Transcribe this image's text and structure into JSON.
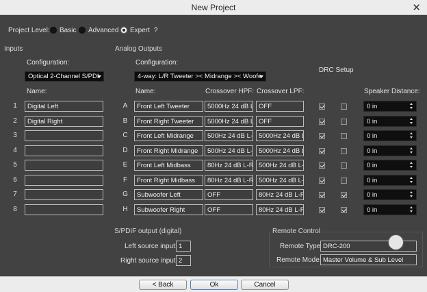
{
  "window": {
    "title": "New Project",
    "close_glyph": "✕"
  },
  "project_level": {
    "label": "Project Level:",
    "options": [
      {
        "label": "Basic",
        "selected": false
      },
      {
        "label": "Advanced",
        "selected": false
      },
      {
        "label": "Expert",
        "selected": true
      }
    ],
    "help": "?"
  },
  "inputs": {
    "section_title": "Inputs",
    "config_label": "Configuration:",
    "config_value": "Optical 2-Channel S/PDI",
    "name_header": "Name:",
    "rows": [
      {
        "index": "1",
        "name": "Digital Left"
      },
      {
        "index": "2",
        "name": "Digital Right"
      },
      {
        "index": "3",
        "name": ""
      },
      {
        "index": "4",
        "name": ""
      },
      {
        "index": "5",
        "name": ""
      },
      {
        "index": "6",
        "name": ""
      },
      {
        "index": "7",
        "name": ""
      },
      {
        "index": "8",
        "name": ""
      }
    ]
  },
  "outputs": {
    "section_title": "Analog Outputs",
    "config_label": "Configuration:",
    "config_value": "4-way: L/R Tweeter >< Midrange >< Woofe",
    "drc_header": "DRC Setup",
    "headers": {
      "name": "Name:",
      "hpf": "Crossover HPF:",
      "lpf": "Crossover LPF:",
      "distance": "Speaker Distance:"
    },
    "rows": [
      {
        "letter": "A",
        "name": "Front Left Tweeter",
        "hpf": "5000Hz 24 dB L-R",
        "lpf": "OFF",
        "drc1": true,
        "drc2": false,
        "distance": "0 in"
      },
      {
        "letter": "B",
        "name": "Front Right Tweeter",
        "hpf": "5000Hz 24 dB L-R",
        "lpf": "OFF",
        "drc1": true,
        "drc2": false,
        "distance": "0 in"
      },
      {
        "letter": "C",
        "name": "Front Left Midrange",
        "hpf": "500Hz 24 dB L-R",
        "lpf": "5000Hz 24 dB L-R",
        "drc1": true,
        "drc2": false,
        "distance": "0 in"
      },
      {
        "letter": "D",
        "name": "Front Right Midrange",
        "hpf": "500Hz 24 dB L-R",
        "lpf": "5000Hz 24 dB L-R",
        "drc1": true,
        "drc2": false,
        "distance": "0 in"
      },
      {
        "letter": "E",
        "name": "Front Left Midbass",
        "hpf": "80Hz 24 dB L-R",
        "lpf": "500Hz 24 dB L-R",
        "drc1": true,
        "drc2": false,
        "distance": "0 in"
      },
      {
        "letter": "F",
        "name": "Front Right Midbass",
        "hpf": "80Hz 24 dB L-R",
        "lpf": "500Hz 24 dB L-R",
        "drc1": true,
        "drc2": false,
        "distance": "0 in"
      },
      {
        "letter": "G",
        "name": "Subwoofer Left",
        "hpf": "OFF",
        "lpf": "80Hz 24 dB L-R",
        "drc1": true,
        "drc2": true,
        "distance": "0 in"
      },
      {
        "letter": "H",
        "name": "Subwoofer Right",
        "hpf": "OFF",
        "lpf": "80Hz 24 dB L-R",
        "drc1": true,
        "drc2": true,
        "distance": "0 in"
      }
    ]
  },
  "spdif": {
    "section_title": "S/PDIF output (digital)",
    "left_label": "Left source input:",
    "left_value": "1",
    "right_label": "Right source input:",
    "right_value": "2"
  },
  "remote": {
    "section_title": "Remote Control",
    "type_label": "Remote Type:",
    "type_value": "DRC-200",
    "mode_label": "Remote Mode:",
    "mode_value": "Master Volume & Sub Level"
  },
  "footer": {
    "back": "< Back",
    "ok": "Ok",
    "cancel": "Cancel"
  }
}
